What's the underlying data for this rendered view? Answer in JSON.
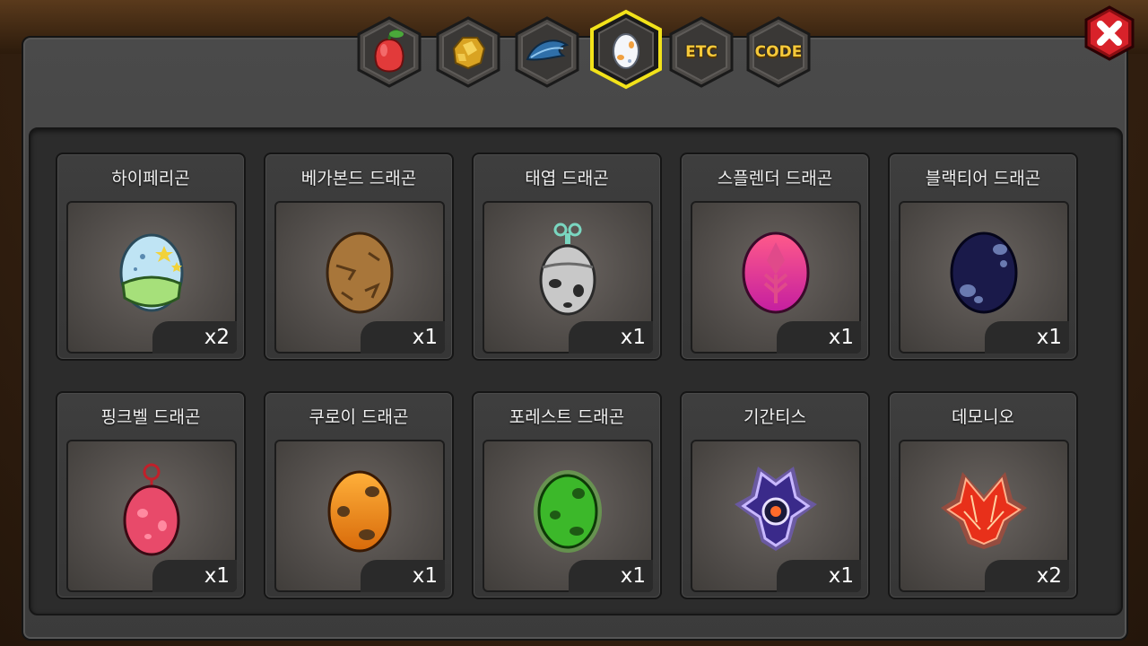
{
  "tabs": [
    {
      "name": "fruit",
      "icon": "fruit-icon",
      "label": ""
    },
    {
      "name": "ore",
      "icon": "ore-icon",
      "label": ""
    },
    {
      "name": "feather",
      "icon": "feather-icon",
      "label": ""
    },
    {
      "name": "egg",
      "icon": "egg-icon",
      "label": "",
      "active": true
    },
    {
      "name": "etc",
      "icon": "",
      "label": "ETC"
    },
    {
      "name": "code",
      "icon": "",
      "label": "CODE"
    }
  ],
  "items": [
    {
      "name": "하이페리곤",
      "qty": "x2",
      "icon": "hyperigon-egg-icon"
    },
    {
      "name": "베가본드 드래곤",
      "qty": "x1",
      "icon": "vagabond-egg-icon"
    },
    {
      "name": "태엽 드래곤",
      "qty": "x1",
      "icon": "clockwork-egg-icon"
    },
    {
      "name": "스플렌더 드래곤",
      "qty": "x1",
      "icon": "splendor-egg-icon"
    },
    {
      "name": "블랙티어 드래곤",
      "qty": "x1",
      "icon": "blacktear-egg-icon"
    },
    {
      "name": "핑크벨 드래곤",
      "qty": "x1",
      "icon": "pinkbell-egg-icon"
    },
    {
      "name": "쿠로이 드래곤",
      "qty": "x1",
      "icon": "kuroi-egg-icon"
    },
    {
      "name": "포레스트 드래곤",
      "qty": "x1",
      "icon": "forest-egg-icon"
    },
    {
      "name": "기간티스",
      "qty": "x1",
      "icon": "gigantis-emblem-icon"
    },
    {
      "name": "데모니오",
      "qty": "x2",
      "icon": "demonio-emblem-icon"
    }
  ],
  "colors": {
    "active_tab_border": "#f2e21a",
    "close_button": "#d8222a",
    "tab_text": "#f6c93a"
  }
}
